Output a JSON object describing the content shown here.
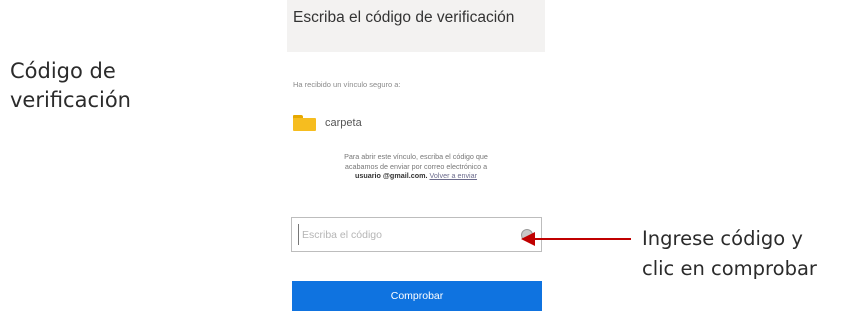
{
  "side_caption": {
    "line1": "Código de",
    "line2": "verificación"
  },
  "panel": {
    "title": "Escriba el código de verificación",
    "received_text": "Ha recibido un vínculo seguro a:",
    "folder": {
      "icon": "folder-icon",
      "name": "carpeta"
    },
    "instructions": {
      "line1": "Para abrir este vínculo, escriba el código que",
      "line2": "acabamos de enviar por correo electrónico a",
      "email": "usuario @gmail.com.",
      "resend_label": "Volver a enviar"
    },
    "code_input": {
      "placeholder": "Escriba el código",
      "value": ""
    },
    "verify_button_label": "Comprobar"
  },
  "hint_caption": {
    "line1": "Ingrese código y",
    "line2": "clic en comprobar"
  },
  "colors": {
    "button": "#0f73e0",
    "arrow": "#c00000",
    "folder": "#f6bd1f",
    "header_bg": "#f3f2f1"
  }
}
